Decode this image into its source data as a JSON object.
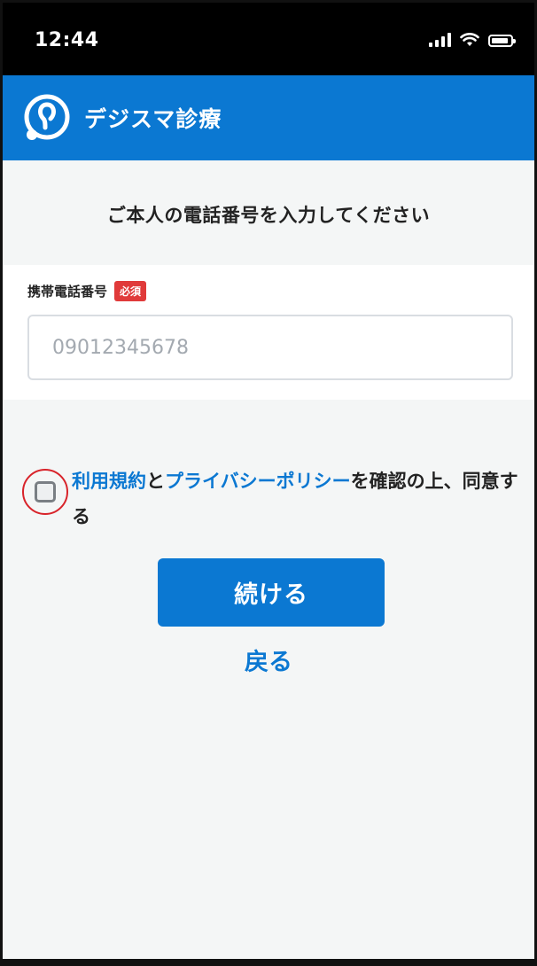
{
  "status_bar": {
    "time": "12:44",
    "icons": [
      "cellular-signal-icon",
      "wifi-icon",
      "battery-icon"
    ]
  },
  "app_bar": {
    "title": "デジスマ診療",
    "logo": "app-logo-icon",
    "color": "#0b78d2"
  },
  "page": {
    "heading": "ご本人の電話番号を入力してください"
  },
  "phone_field": {
    "label": "携帯電話番号",
    "required_badge": "必須",
    "placeholder": "09012345678",
    "value": ""
  },
  "agreement": {
    "checked": false,
    "terms_link": "利用規約",
    "conjunction": "と",
    "privacy_link": "プライバシーポリシー",
    "suffix": "を確認の上、同意する"
  },
  "actions": {
    "continue_label": "続ける",
    "back_label": "戻る"
  },
  "colors": {
    "accent": "#0b78d2",
    "required": "#e03a3a",
    "highlight_ring": "#d8232a"
  }
}
